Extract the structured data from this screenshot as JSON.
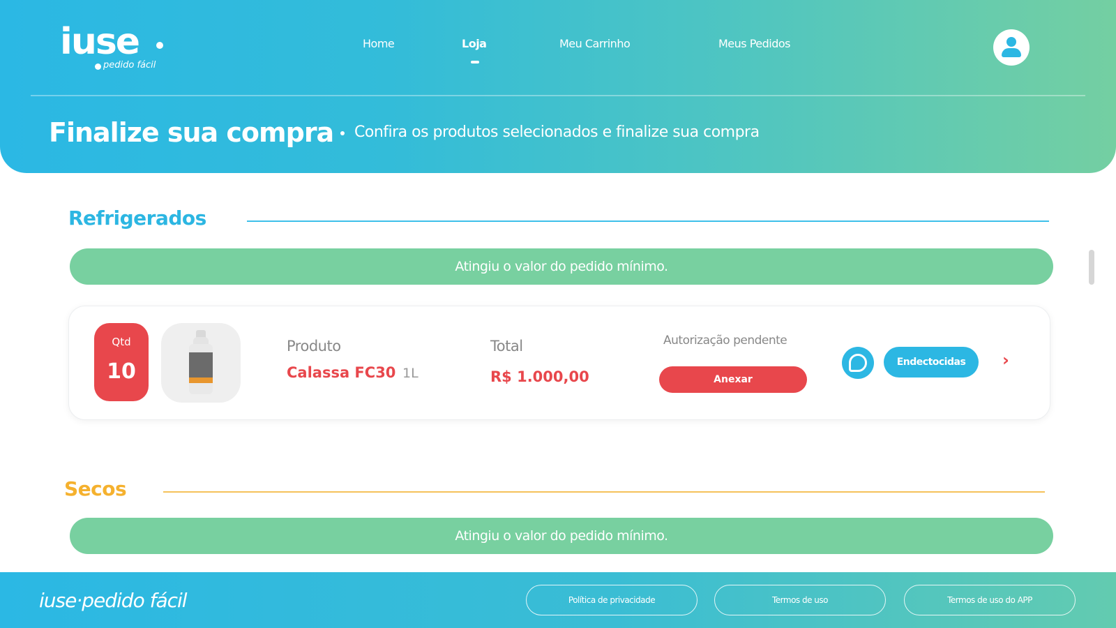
{
  "brand": {
    "logo_main": "iuse",
    "logo_sub": "pedido fácil"
  },
  "nav": {
    "items": [
      {
        "label": "Home"
      },
      {
        "label": "Loja"
      },
      {
        "label": "Meu Carrinho"
      },
      {
        "label": "Meus Pedidos"
      }
    ],
    "active": "Loja"
  },
  "header": {
    "title": "Finalize sua compra",
    "subtitle": "Confira os produtos selecionados e finalize sua compra"
  },
  "sections": [
    {
      "title": "Refrigerados",
      "color": "#2cb6e2",
      "status_message": "Atingiu o valor do pedido mínimo.",
      "items": [
        {
          "qty_label": "Qtd",
          "qty": "10",
          "product_label": "Produto",
          "product_name": "Calassa FC30",
          "product_size": "1L",
          "total_label": "Total",
          "total_value": "R$ 1.000,00",
          "auth_label": "Autorização pendente",
          "attach_label": "Anexar",
          "category_label": "Endectocidas"
        }
      ]
    },
    {
      "title": "Secos",
      "color": "#f5b12e",
      "status_message": "Atingiu o valor do pedido mínimo."
    }
  ],
  "footer": {
    "logo_text": "iuse·pedido fácil",
    "links": [
      {
        "label": "Política de privacidade"
      },
      {
        "label": "Termos de uso"
      },
      {
        "label": "Termos de uso do APP"
      }
    ]
  },
  "colors": {
    "accent_blue": "#2cb7e3",
    "accent_green": "#78d0a0",
    "alert_red": "#e8474c",
    "secos_orange": "#f5b12e"
  },
  "icons": [
    "user-icon",
    "chat-icon",
    "chevron-right-icon",
    "product-bottle-image"
  ]
}
